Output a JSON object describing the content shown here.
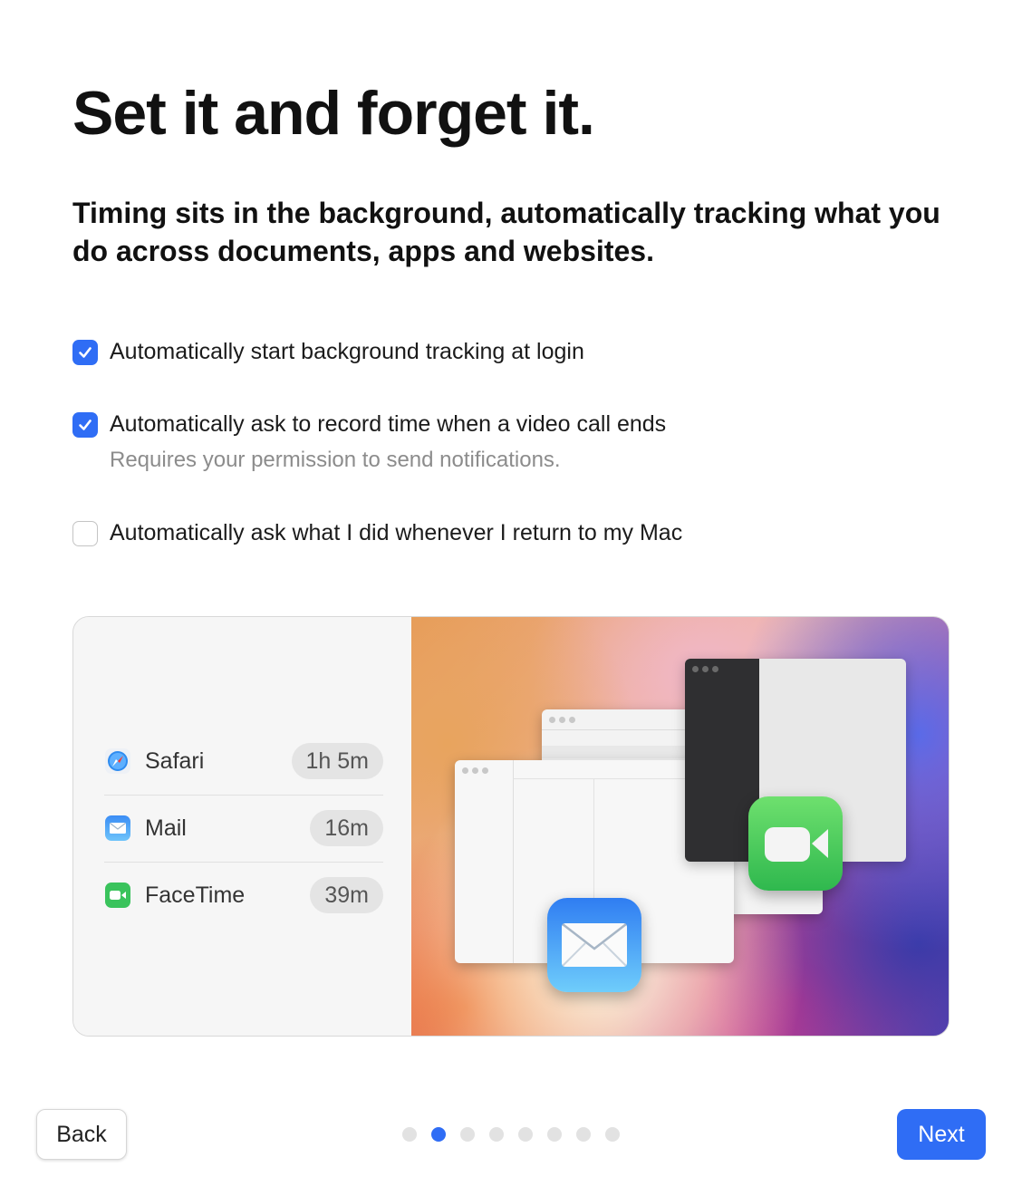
{
  "header": {
    "title": "Set it and forget it.",
    "subtitle": "Timing sits in the background, automatically tracking what you do across documents, apps and websites."
  },
  "options": [
    {
      "label": "Automatically start background tracking at login",
      "checked": true
    },
    {
      "label": "Automatically ask to record time when a video call ends",
      "checked": true,
      "hint": "Requires your permission to send notifications."
    },
    {
      "label": "Automatically ask what I did whenever I return to my Mac",
      "checked": false
    }
  ],
  "preview": {
    "apps": [
      {
        "name": "Safari",
        "duration": "1h 5m",
        "icon": "safari-icon"
      },
      {
        "name": "Mail",
        "duration": "16m",
        "icon": "mail-icon"
      },
      {
        "name": "FaceTime",
        "duration": "39m",
        "icon": "facetime-icon"
      }
    ]
  },
  "footer": {
    "back_label": "Back",
    "next_label": "Next",
    "page_count": 8,
    "current_page": 2
  },
  "colors": {
    "accent": "#2f6df5"
  }
}
